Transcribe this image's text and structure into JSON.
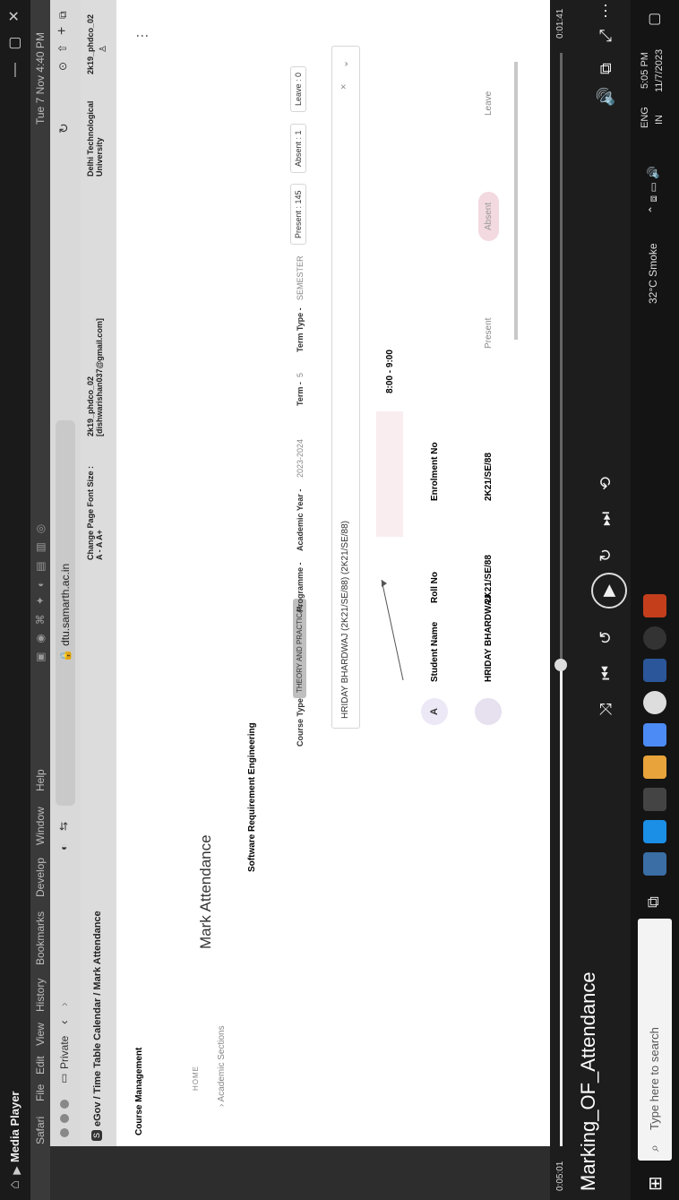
{
  "media_player": {
    "title": "Media Player",
    "video_title": "Marking_OF_Attendance",
    "elapsed": "0:05:01",
    "remaining": "0:01:41",
    "progress_fraction": 0.44
  },
  "mac_menu": {
    "items": [
      "Safari",
      "File",
      "Edit",
      "View",
      "History",
      "Bookmarks",
      "Develop",
      "Window",
      "Help"
    ],
    "clock": "Tue 7 Nov 4:40 PM"
  },
  "browser": {
    "tab_label": "Private",
    "url": "dtu.samarth.ac.in",
    "breadcrumb": "eGov / Time Table Calendar / Mark Attendance",
    "font_size": "Change Page Font Size : A - A A+",
    "user": "2k19_phdco_02 [dishwarishan037@gmail.com]",
    "university": "Delhi Technological University",
    "user_short": "2k19_phdco_02"
  },
  "page": {
    "sidebar_heading": "Course Management",
    "home": "HOME",
    "academic_sections": "Academic Sections",
    "title": "Mark Attendance",
    "course_name": "Software Requirement Engineering",
    "course_type_label": "Course Type",
    "course_type_value": "THEORY AND PRACTICAL",
    "programme": "Programme -",
    "academic_year_label": "Academic Year -",
    "academic_year_value": "2023-2024",
    "term_label": "Term -",
    "term_value": "5",
    "term_type_label": "Term Type -",
    "term_type_value": "SEMESTER",
    "present_count": "Present : 145",
    "absent_count": "Absent : 1",
    "leave_count": "Leave : 0",
    "selected_student": "HRIDAY BHARDWAJ (2K21/SE/88) (2K21/SE/88)",
    "time_slot": "8:00 - 9:00",
    "table_headers": [
      "Student Name",
      "Roll No",
      "Enrolment No"
    ],
    "row": {
      "name": "HRIDAY BHARDWAJ",
      "roll": "2K21/SE/88",
      "enrolment": "2K21/SE/88",
      "present": "Present",
      "absent": "Absent",
      "leave": "Leave"
    },
    "avatar_letter": "A"
  },
  "taskbar": {
    "search_placeholder": "Type here to search",
    "weather": "32°C Smoke",
    "lang": "ENG",
    "region": "IN",
    "time": "5:05 PM",
    "date": "11/7/2023"
  }
}
